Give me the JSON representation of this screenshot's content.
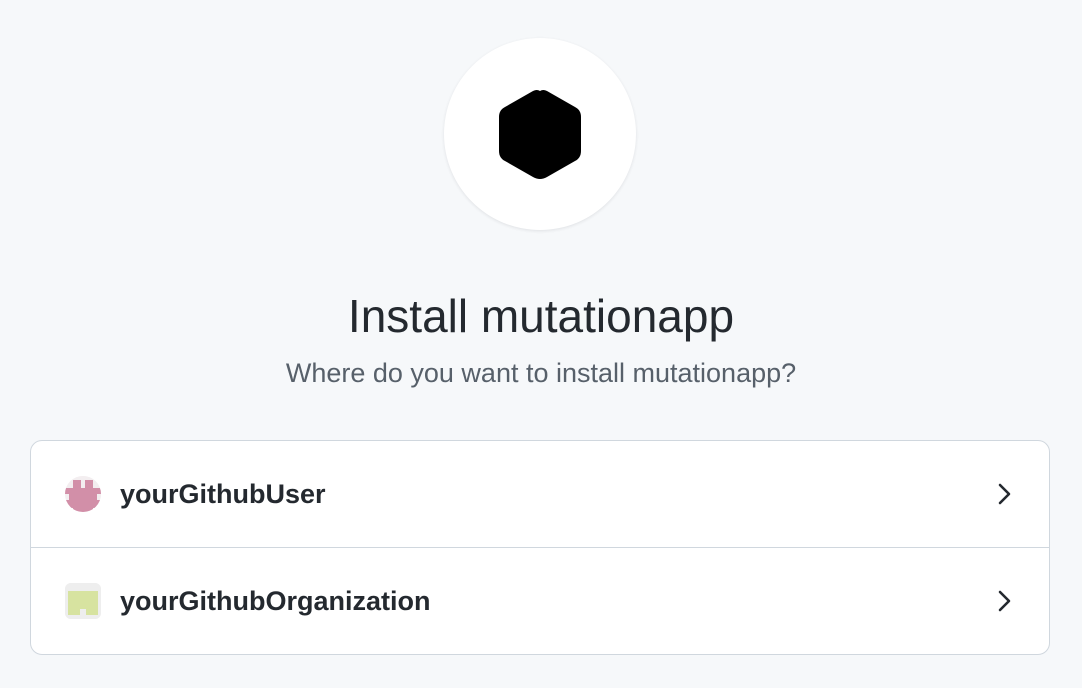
{
  "app": {
    "title": "Install mutationapp",
    "subtitle": "Where do you want to install mutationapp?",
    "logo_icon": "hexagon-icon"
  },
  "accounts": [
    {
      "name": "yourGithubUser",
      "avatar_icon": "identicon-user-avatar",
      "avatar_color": "#d28fa8"
    },
    {
      "name": "yourGithubOrganization",
      "avatar_icon": "identicon-org-avatar",
      "avatar_color": "#d7e3a0"
    }
  ],
  "colors": {
    "background": "#f6f8fa",
    "title": "#24292f",
    "subtitle": "#57606a",
    "border": "#d0d7de"
  }
}
